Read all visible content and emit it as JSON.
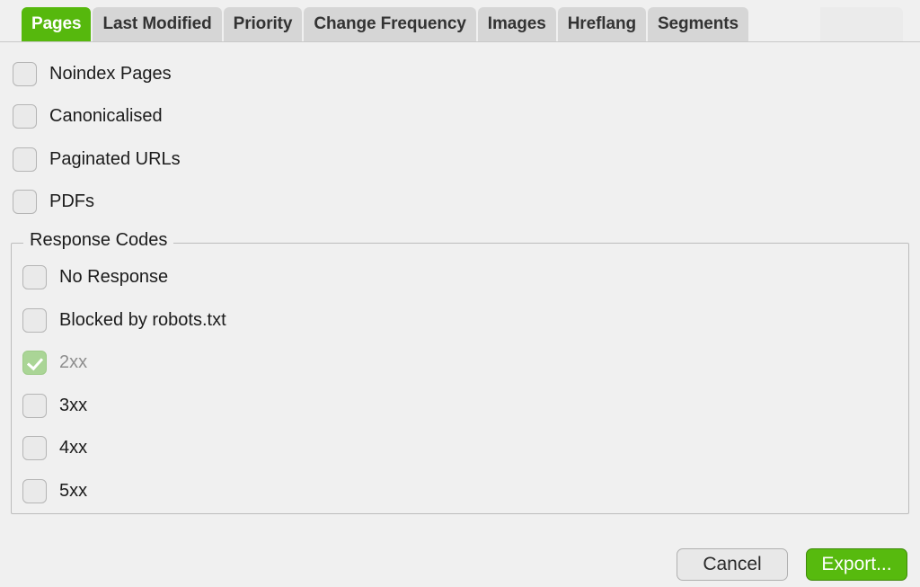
{
  "window": {
    "background_color": "#f0f0f0",
    "accent_green": "#56b80d",
    "checked_disabled_green": "#aad596"
  },
  "tabs": {
    "active_index": 0,
    "items": [
      {
        "label": "Pages"
      },
      {
        "label": "Last Modified"
      },
      {
        "label": "Priority"
      },
      {
        "label": "Change Frequency"
      },
      {
        "label": "Images"
      },
      {
        "label": "Hreflang"
      },
      {
        "label": "Segments"
      }
    ]
  },
  "page_options": [
    {
      "label": "Noindex Pages",
      "checked": false,
      "disabled": false
    },
    {
      "label": "Canonicalised",
      "checked": false,
      "disabled": false
    },
    {
      "label": "Paginated URLs",
      "checked": false,
      "disabled": false
    },
    {
      "label": "PDFs",
      "checked": false,
      "disabled": false
    }
  ],
  "response_codes": {
    "title": "Response Codes",
    "items": [
      {
        "label": "No Response",
        "checked": false,
        "disabled": false
      },
      {
        "label": "Blocked by robots.txt",
        "checked": false,
        "disabled": false
      },
      {
        "label": "2xx",
        "checked": true,
        "disabled": true
      },
      {
        "label": "3xx",
        "checked": false,
        "disabled": false
      },
      {
        "label": "4xx",
        "checked": false,
        "disabled": false
      },
      {
        "label": "5xx",
        "checked": false,
        "disabled": false
      }
    ]
  },
  "footer": {
    "cancel_label": "Cancel",
    "export_label": "Export..."
  }
}
